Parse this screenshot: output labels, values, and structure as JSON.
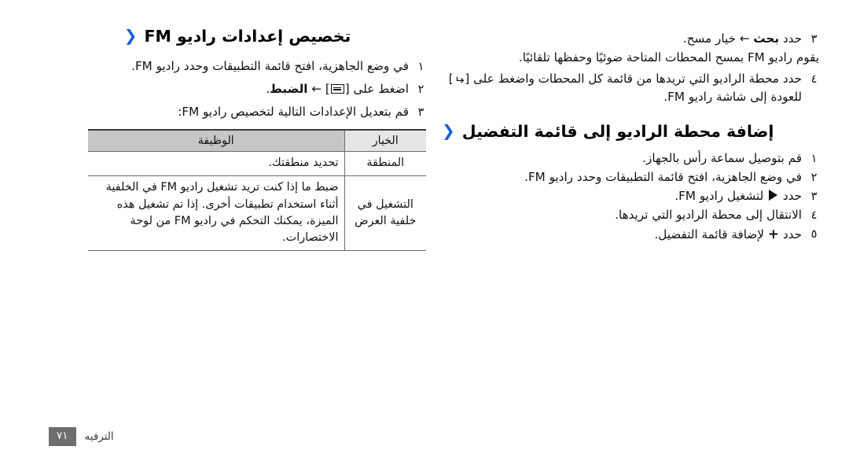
{
  "page": {
    "language": "ar",
    "direction": "rtl",
    "accent_color": "#1b5fd2",
    "table_header_option_bg": "#e6e6e6",
    "table_header_function_bg": "#c6c6c6",
    "footer_badge_bg": "#6e6e6e"
  },
  "right_column": {
    "continued_steps": [
      {
        "num": "٣",
        "text_before_bold": "حدد ",
        "bold": "بحث",
        "text_after_bold": " ← خيار مسح."
      },
      {
        "num": "٤",
        "text_a": "حدد محطة الراديو التي تريدها من قائمة كل المحطات واضغط على [",
        "icon": "back-key-icon",
        "text_b": "] للعودة إلى شاشة راديو FM."
      }
    ],
    "note_after_step3": "يقوم راديو FM بمسح المحطات المتاحة ضوئيًا وحفظها تلقائيًا.",
    "section": {
      "chevron": "‹",
      "title": "إضافة محطة الراديو إلى قائمة التفضيل",
      "steps": [
        {
          "num": "١",
          "text": "قم بتوصيل سماعة رأس بالجهاز."
        },
        {
          "num": "٢",
          "text": "في وضع الجاهزية، افتح قائمة التطبيقات وحدد راديو FM."
        },
        {
          "num": "٣",
          "text_a": "حدد ",
          "icon": "play-icon",
          "text_b": " لتشغيل راديو FM."
        },
        {
          "num": "٤",
          "text": "الانتقال إلى محطة الراديو التي تريدها."
        },
        {
          "num": "٥",
          "text_a": "حدد ",
          "icon": "plus-icon",
          "text_b": " لإضافة قائمة التفضيل."
        }
      ]
    }
  },
  "left_column": {
    "section": {
      "chevron": "‹",
      "title": "تخصيص إعدادات راديو FM",
      "steps": [
        {
          "num": "١",
          "text": "في وضع الجاهزية، افتح قائمة التطبيقات وحدد راديو FM."
        },
        {
          "num": "٢",
          "text_a": "اضغط على [",
          "icon": "menu-key-icon",
          "text_b": "] ← ",
          "bold": "الضبط",
          "text_c": "."
        },
        {
          "num": "٣",
          "text": "قم بتعديل الإعدادات التالية لتخصيص راديو FM:"
        }
      ]
    },
    "table": {
      "headers": [
        "الخيار",
        "الوظيفة"
      ],
      "rows": [
        {
          "option": "المنطقة",
          "function": "تحديد منطقتك."
        },
        {
          "option": "التشغيل في خلفية العرض",
          "function": "ضبط ما إذا كنت تريد تشغيل راديو FM في الخلفية أثناء استخدام تطبيقات أخرى. إذا تم تشغيل هذه الميزة، يمكنك التحكم في راديو FM من لوحة الاختصارات."
        }
      ]
    }
  },
  "footer": {
    "page_number": "٧١",
    "label": "الترفيه"
  }
}
